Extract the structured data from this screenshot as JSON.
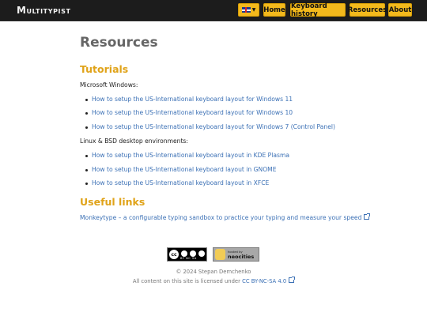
{
  "header": {
    "brand": "Multitypist",
    "nav": {
      "home": "Home",
      "keyboard_history": "Keyboard history",
      "resources": "Resources",
      "about": "About"
    },
    "language_selector": {
      "icon": "uk-flag-icon",
      "caret_icon": "chevron-down-icon"
    }
  },
  "page": {
    "title": "Resources",
    "tutorials": {
      "heading": "Tutorials",
      "windows_label": "Microsoft Windows:",
      "windows_links": [
        "How to setup the US-International keyboard layout for Windows 11",
        "How to setup the US-International keyboard layout for Windows 10",
        "How to setup the US-International keyboard layout for Windows 7 (Control Panel)"
      ],
      "linux_label": "Linux & BSD desktop environments:",
      "linux_links": [
        "How to setup the US-International keyboard layout in KDE Plasma",
        "How to setup the US-International keyboard layout in GNOME",
        "How to setup the US-International keyboard layout in XFCE"
      ]
    },
    "useful_links": {
      "heading": "Useful links",
      "monkeytype": "Monkeytype – a configurable typing sandbox to practice your typing and measure your speed"
    }
  },
  "footer": {
    "cc_badge_text": "BY  NC  SA",
    "neocities_small": "hosted by",
    "neocities_big": "neocities",
    "copyright": "© 2024 Stepan Demchenko",
    "license_prefix": "All content on this site is licensed under",
    "license_link": "CC BY-NC-SA 4.0"
  }
}
